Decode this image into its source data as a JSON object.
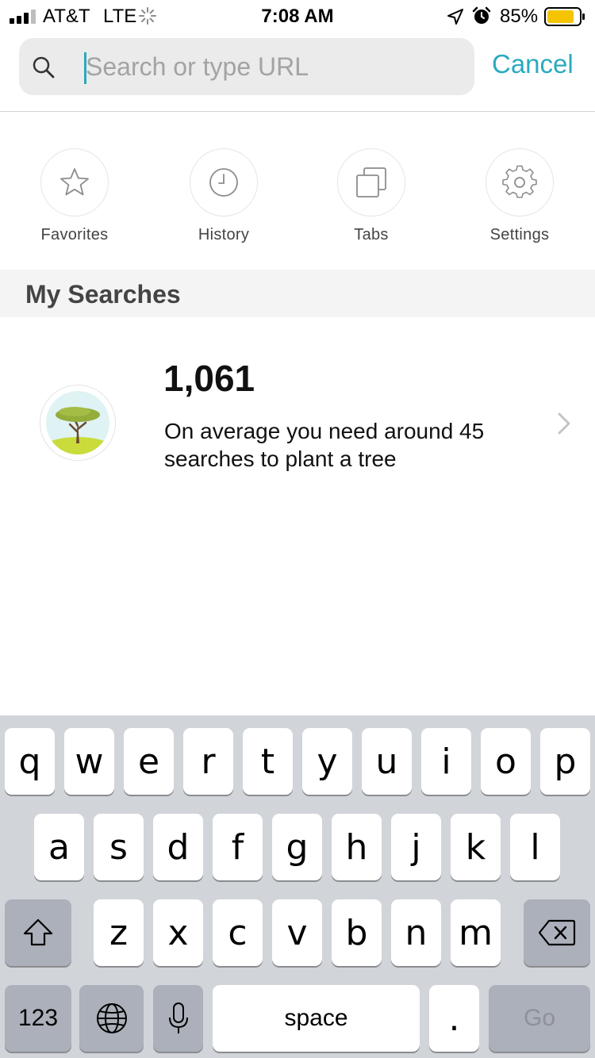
{
  "status_bar": {
    "carrier": "AT&T",
    "network": "LTE",
    "time": "7:08 AM",
    "battery_percent": "85%",
    "battery_level": 0.85,
    "battery_color": "#f4c400"
  },
  "search": {
    "placeholder": "Search or type URL",
    "value": "",
    "cancel_label": "Cancel",
    "accent_color": "#2aaabf"
  },
  "shortcuts": [
    {
      "label": "Favorites",
      "icon": "star-icon"
    },
    {
      "label": "History",
      "icon": "clock-icon"
    },
    {
      "label": "Tabs",
      "icon": "tabs-icon"
    },
    {
      "label": "Settings",
      "icon": "gear-icon"
    }
  ],
  "my_searches": {
    "section_title": "My Searches",
    "count": "1,061",
    "description": "On average you need around 45 searches to plant a tree",
    "icon": "tree-icon"
  },
  "keyboard": {
    "row1": [
      "q",
      "w",
      "e",
      "r",
      "t",
      "y",
      "u",
      "i",
      "o",
      "p"
    ],
    "row2": [
      "a",
      "s",
      "d",
      "f",
      "g",
      "h",
      "j",
      "k",
      "l"
    ],
    "row3": [
      "z",
      "x",
      "c",
      "v",
      "b",
      "n",
      "m"
    ],
    "shift_icon": "shift-icon",
    "backspace_icon": "backspace-icon",
    "numbers_label": "123",
    "globe_icon": "globe-icon",
    "mic_icon": "microphone-icon",
    "space_label": "space",
    "period_label": ".",
    "go_label": "Go"
  }
}
